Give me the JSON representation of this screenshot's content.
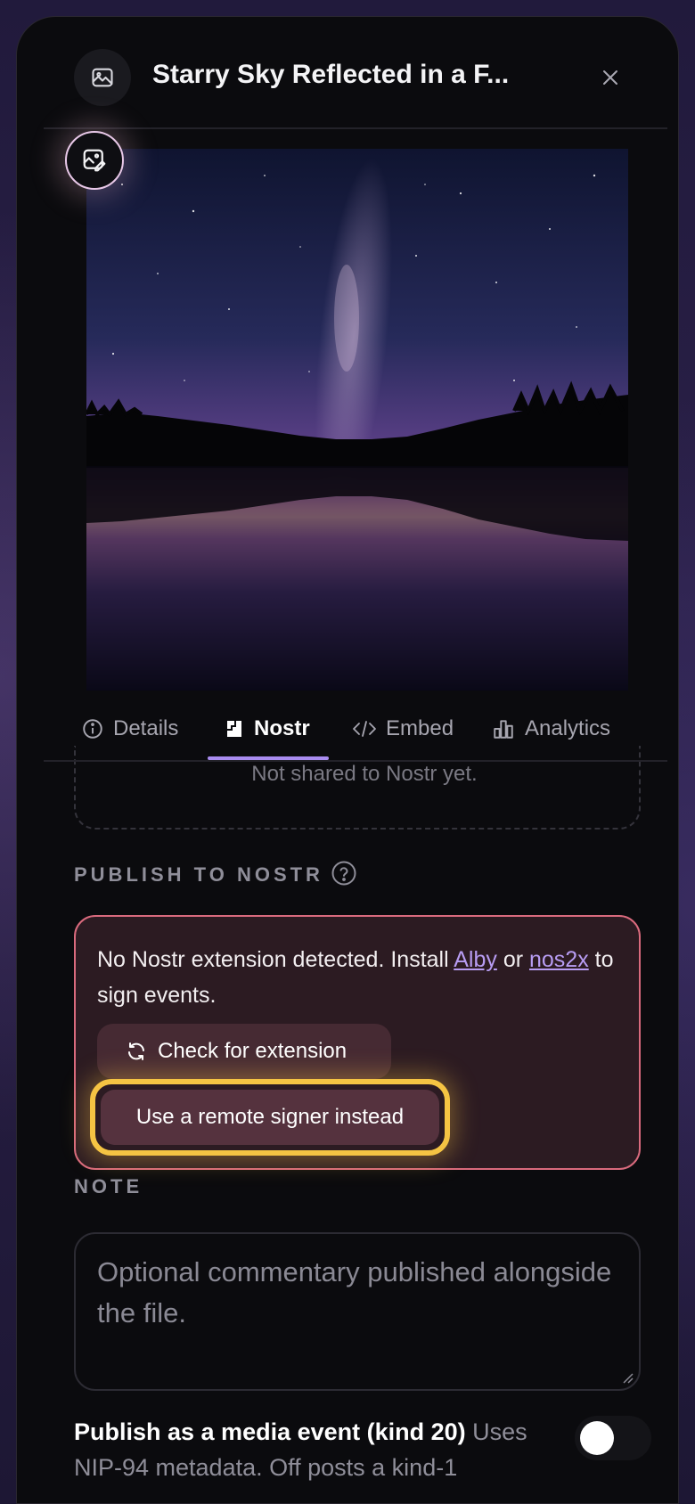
{
  "header": {
    "title": "Starry Sky Reflected in a F...",
    "image_icon": "image-icon",
    "close_icon": "close-icon"
  },
  "preview": {
    "edit_icon": "edit-image-icon"
  },
  "tabs": [
    {
      "label": "Details",
      "icon": "info-icon",
      "active": false
    },
    {
      "label": "Nostr",
      "icon": "nostr-icon",
      "active": true
    },
    {
      "label": "Embed",
      "icon": "code-icon",
      "active": false
    },
    {
      "label": "Analytics",
      "icon": "bar-chart-icon",
      "active": false
    }
  ],
  "shared_status": "Not shared to Nostr yet.",
  "publish": {
    "section_label": "PUBLISH TO NOSTR",
    "help_icon": "help-icon",
    "alert": {
      "text_before": "No Nostr extension detected. Install ",
      "link1": "Alby",
      "text_mid": " or ",
      "link2": "nos2x",
      "text_after": " to sign events.",
      "check_button": "Check for extension",
      "check_icon": "refresh-icon",
      "remote_button": "Use a remote signer instead"
    }
  },
  "note": {
    "label": "NOTE",
    "placeholder": "Optional commentary published alongside the file."
  },
  "media_event": {
    "title": "Publish as a media event (kind 20)",
    "description": "Uses NIP-94 metadata. Off posts a kind-1",
    "enabled": false
  },
  "colors": {
    "accent": "#a98cf0",
    "alert_border": "#d96a7d",
    "focus_ring": "#f5c443"
  }
}
